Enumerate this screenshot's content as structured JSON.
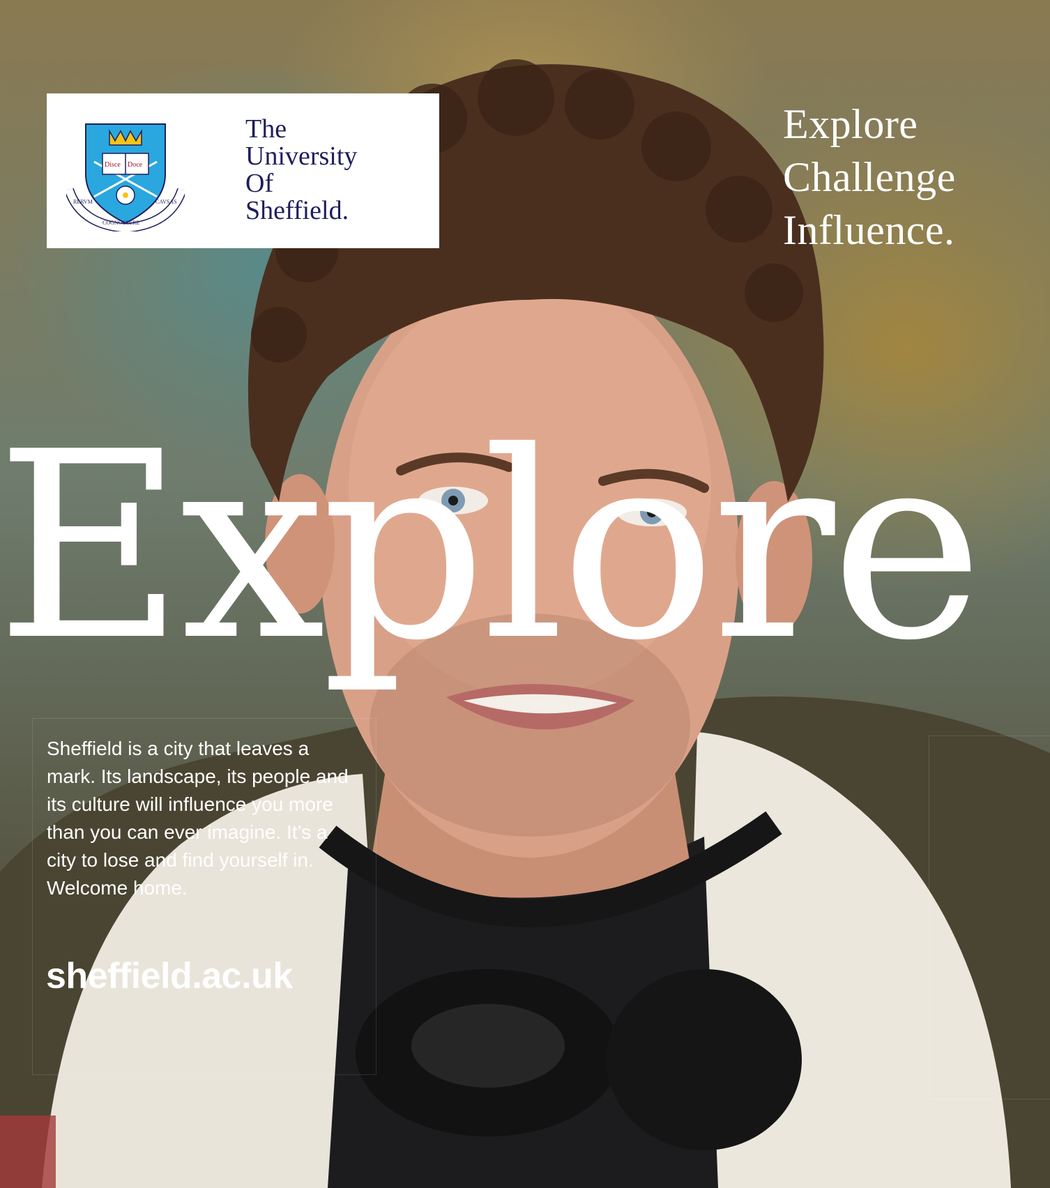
{
  "logo": {
    "line1": "The",
    "line2": "University",
    "line3": "Of",
    "line4": "Sheffield."
  },
  "tagline": [
    "Explore",
    "Challenge",
    "Influence."
  ],
  "headline": "Explore",
  "body_text": "Sheffield is a city that leaves a mark. Its landscape, its people and its culture will influence you more than you can ever imagine. It’s a city to lose and find yourself in. Welcome home.",
  "url": "sheffield.ac.uk",
  "colors": {
    "brand_navy": "#1f1e5c",
    "text_white": "#ffffff"
  }
}
